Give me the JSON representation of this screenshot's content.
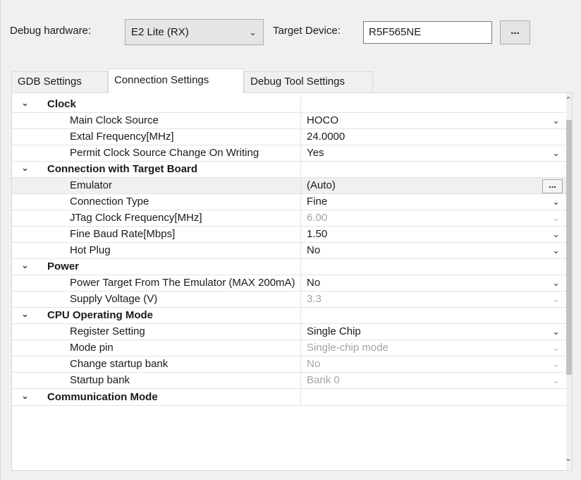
{
  "header": {
    "debug_hardware_label": "Debug hardware:",
    "debug_hardware_value": "E2 Lite (RX)",
    "target_device_label": "Target Device:",
    "target_device_value": "R5F565NE",
    "browse_label": "..."
  },
  "tabs": [
    {
      "label": "GDB Settings",
      "active": false
    },
    {
      "label": "Connection Settings",
      "active": true
    },
    {
      "label": "Debug Tool Settings",
      "active": false
    }
  ],
  "categories": {
    "clock": {
      "label": "Clock",
      "rows": [
        {
          "name": "Main Clock Source",
          "value": "HOCO"
        },
        {
          "name": "Extal Frequency[MHz]",
          "value": "24.0000"
        },
        {
          "name": "Permit Clock Source Change On Writing",
          "value": "Yes"
        }
      ]
    },
    "connection": {
      "label": "Connection with Target Board",
      "rows": [
        {
          "name": "Emulator",
          "value": "(Auto)",
          "button": "..."
        },
        {
          "name": "Connection Type",
          "value": "Fine"
        },
        {
          "name": "JTag Clock Frequency[MHz]",
          "value": "6.00"
        },
        {
          "name": "Fine Baud Rate[Mbps]",
          "value": "1.50"
        },
        {
          "name": "Hot Plug",
          "value": "No"
        }
      ]
    },
    "power": {
      "label": "Power",
      "rows": [
        {
          "name": "Power Target From The Emulator (MAX 200mA)",
          "value": "No"
        },
        {
          "name": "Supply Voltage (V)",
          "value": "3.3"
        }
      ]
    },
    "cpu": {
      "label": "CPU Operating Mode",
      "rows": [
        {
          "name": "Register Setting",
          "value": "Single Chip"
        },
        {
          "name": "Mode pin",
          "value": "Single-chip mode"
        },
        {
          "name": "Change startup bank",
          "value": "No"
        },
        {
          "name": "Startup bank",
          "value": "Bank 0"
        }
      ]
    },
    "communication": {
      "label": "Communication Mode"
    }
  },
  "icons": {
    "expanded": "chevron-down-icon",
    "dropdown": "chevron-down-icon",
    "scroll_up": "chevron-up-icon",
    "scroll_down": "chevron-down-icon"
  }
}
